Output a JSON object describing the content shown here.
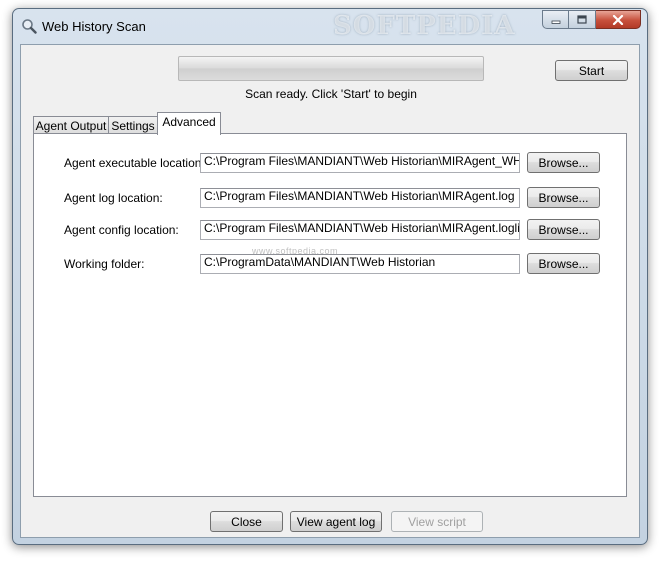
{
  "window": {
    "title": "Web History Scan",
    "watermark_title": "SOFTPEDIA",
    "caption": {
      "minimize_icon": "minimize-icon",
      "maximize_icon": "maximize-icon",
      "close_icon": "close-icon"
    }
  },
  "scan": {
    "progress": 0,
    "status": "Scan ready.  Click 'Start' to begin",
    "start_label": "Start"
  },
  "tabs": [
    {
      "label": "Agent Output",
      "active": false
    },
    {
      "label": "Settings",
      "active": false
    },
    {
      "label": "Advanced",
      "active": true
    }
  ],
  "advanced": {
    "rows": [
      {
        "label": "Agent executable location:",
        "value": "C:\\Program Files\\MANDIANT\\Web Historian\\MIRAgent_WH.exe",
        "browse": "Browse..."
      },
      {
        "label": "Agent log location:",
        "value": "C:\\Program Files\\MANDIANT\\Web Historian\\MIRAgent.log",
        "browse": "Browse..."
      },
      {
        "label": "Agent config location:",
        "value": "C:\\Program Files\\MANDIANT\\Web Historian\\MIRAgent.loglite.conf",
        "browse": "Browse..."
      },
      {
        "label": "Working folder:",
        "value": "C:\\ProgramData\\MANDIANT\\Web Historian",
        "browse": "Browse..."
      }
    ],
    "watermark": "www.softpedia.com"
  },
  "footer": {
    "close_label": "Close",
    "view_log_label": "View agent log",
    "view_script_label": "View script"
  },
  "colors": {
    "window_frame": "#c3d2e1",
    "close_button": "#c7503c",
    "client_bg": "#f0f0f0"
  }
}
